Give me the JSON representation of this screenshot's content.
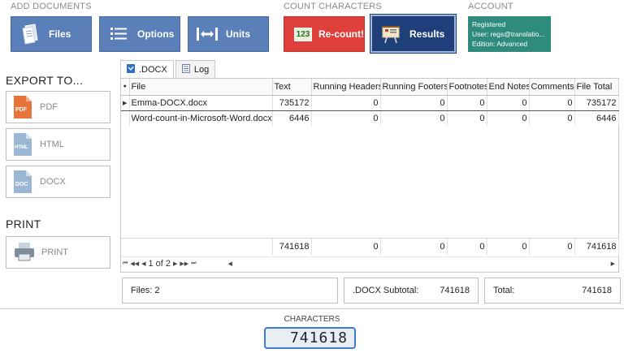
{
  "sections": {
    "add_documents": "ADD DOCUMENTS",
    "count_characters": "COUNT CHARACTERS",
    "account": "ACCOUNT"
  },
  "toolbar": {
    "files": "Files",
    "options": "Options",
    "units": "Units",
    "recount": "Re-count!",
    "recount_badge": "123",
    "results": "Results"
  },
  "account": {
    "line1": "Registered",
    "line2": "User: regs@translatio...",
    "line3": "Edition: Advanced"
  },
  "left": {
    "export_heading": "EXPORT TO...",
    "pdf": "PDF",
    "pdf_icon_text": "PDF",
    "html": "HTML",
    "html_icon_text": "HTML",
    "docx": "DOCX",
    "docx_icon_text": "DOC",
    "print_heading": "PRINT",
    "print": "PRINT"
  },
  "tabs": [
    {
      "label": ".DOCX"
    },
    {
      "label": "Log"
    }
  ],
  "grid": {
    "columns": [
      "File",
      "Text",
      "Running Headers",
      "Running Footers",
      "Footnotes",
      "End Notes",
      "Comments",
      "File Total"
    ],
    "rows": [
      [
        "Emma-DOCX.docx",
        "735172",
        "0",
        "0",
        "0",
        "0",
        "0",
        "735172"
      ],
      [
        "Word-count-in-Microsoft-Word.docx",
        "6446",
        "0",
        "0",
        "0",
        "0",
        "0",
        "6446"
      ]
    ],
    "totals": [
      "741618",
      "0",
      "0",
      "0",
      "0",
      "0",
      "741618"
    ],
    "pager": "1 of 2"
  },
  "summary": {
    "files": "Files: 2",
    "subtotal_label": ".DOCX Subtotal:",
    "subtotal_value": "741618",
    "total_label": "Total:",
    "total_value": "741618"
  },
  "characters": {
    "label": "CHARACTERS",
    "value": "741618"
  },
  "colors": {
    "toolbar_button": "#5b7fb8",
    "recount": "#e0403c",
    "results": "#1e3f7a",
    "account": "#2f8c7c",
    "counter_border": "#3c7bd1"
  }
}
